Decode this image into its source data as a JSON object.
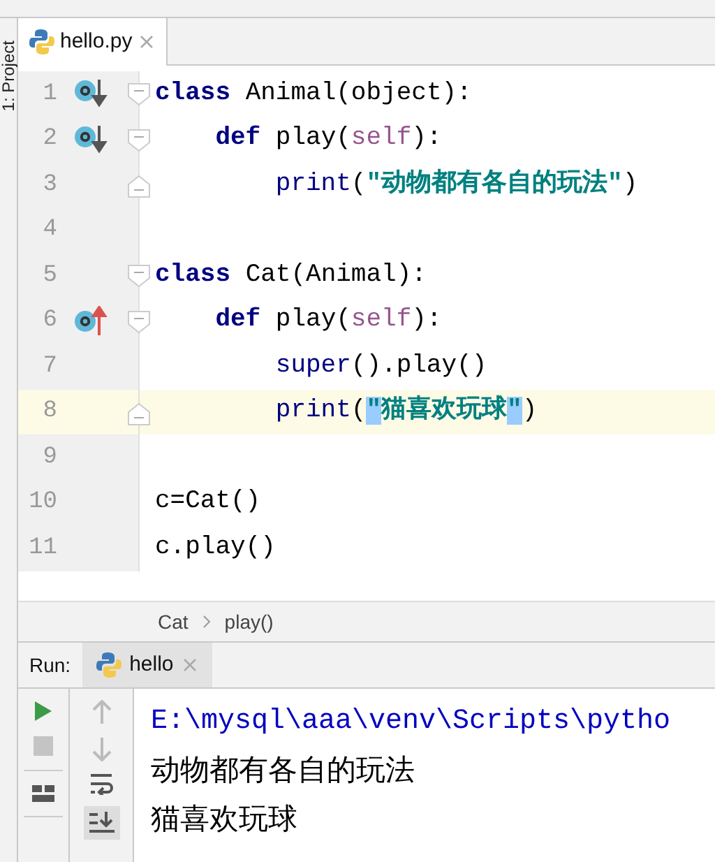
{
  "side_tool_tab": {
    "label": "1: Project"
  },
  "editor_tabs": [
    {
      "label": "hello.py",
      "selected": true
    }
  ],
  "code_lines": [
    {
      "number": "1",
      "gutter_icon": {
        "kind": "implemented"
      },
      "fold_marker": {
        "kind": "start"
      },
      "current": false,
      "tokens": [
        {
          "kind": "kw",
          "t": "class"
        },
        {
          "kind": "plain",
          "t": " Animal(object):"
        }
      ],
      "children": [
        {
          "number": "2",
          "gutter_icon": {
            "kind": "implemented"
          },
          "fold_marker": {
            "kind": "start"
          },
          "current": false,
          "tokens": [
            {
              "kind": "kw",
              "t": "def"
            },
            {
              "kind": "plain",
              "t": " play("
            },
            {
              "kind": "self",
              "t": "self"
            },
            {
              "kind": "plain",
              "t": "):"
            }
          ],
          "children": [
            {
              "number": "3",
              "fold_marker": {
                "kind": "end"
              },
              "current": false,
              "tokens": [
                {
                  "kind": "builtin",
                  "t": "print"
                },
                {
                  "kind": "plain",
                  "t": "("
                },
                {
                  "kind": "str",
                  "t": "\"动物都有各自的玩法\""
                },
                {
                  "kind": "plain",
                  "t": ")"
                }
              ]
            }
          ]
        }
      ]
    },
    {
      "number": "4",
      "current": false
    },
    {
      "number": "5",
      "fold_marker": {
        "kind": "start"
      },
      "current": false,
      "tokens": [
        {
          "kind": "kw",
          "t": "class"
        },
        {
          "kind": "plain",
          "t": " Cat(Animal):"
        }
      ],
      "children": [
        {
          "number": "6",
          "gutter_icon": {
            "kind": "overrides"
          },
          "fold_marker": {
            "kind": "start"
          },
          "current": false,
          "tokens": [
            {
              "kind": "kw",
              "t": "def"
            },
            {
              "kind": "plain",
              "t": " play("
            },
            {
              "kind": "self",
              "t": "self"
            },
            {
              "kind": "plain",
              "t": "):"
            }
          ],
          "children": [
            {
              "number": "7",
              "current": false,
              "tokens": [
                {
                  "kind": "builtin",
                  "t": "super"
                },
                {
                  "kind": "plain",
                  "t": "().play()"
                }
              ]
            },
            {
              "number": "8",
              "fold_marker": {
                "kind": "end"
              },
              "current": true,
              "tokens": [
                {
                  "kind": "builtin",
                  "t": "print"
                },
                {
                  "kind": "plain",
                  "t": "("
                },
                {
                  "kind": "str",
                  "t": "\"",
                  "match": true
                },
                {
                  "kind": "str",
                  "t": "猫喜欢玩球"
                },
                {
                  "kind": "str",
                  "t": "\"",
                  "match": true
                },
                {
                  "kind": "plain",
                  "t": ")"
                }
              ]
            }
          ]
        }
      ]
    },
    {
      "number": "9",
      "current": false
    },
    {
      "number": "10",
      "current": false,
      "tokens": [
        {
          "kind": "plain",
          "t": "c=Cat()"
        }
      ]
    },
    {
      "number": "11",
      "current": false,
      "tokens": [
        {
          "kind": "plain",
          "t": "c.play()"
        }
      ]
    }
  ],
  "breadcrumbs": [
    "Cat",
    "play()"
  ],
  "run_panel": {
    "label": "Run:",
    "tabs": [
      {
        "label": "hello",
        "selected": true
      }
    ],
    "output": [
      {
        "kind": "command",
        "text": "E:\\mysql\\aaa\\venv\\Scripts\\pytho"
      },
      {
        "kind": "stdout",
        "text": "动物都有各自的玩法"
      },
      {
        "kind": "stdout",
        "text": "猫喜欢玩球"
      }
    ]
  }
}
